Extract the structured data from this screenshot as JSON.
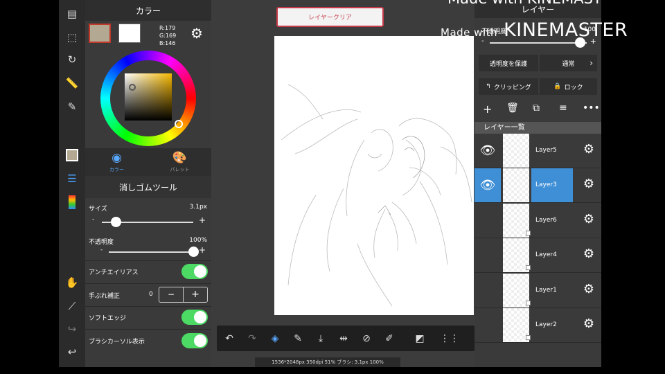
{
  "color_panel": {
    "title": "カラー",
    "rgb": {
      "r": "R:179",
      "g": "G:169",
      "b": "B:146"
    },
    "primary_color": "#b3a992",
    "tabs": [
      {
        "label": "カラー"
      },
      {
        "label": "パレット"
      }
    ]
  },
  "tool": {
    "name": "消しゴムツール",
    "size_label": "サイズ",
    "size_value": "3.1px",
    "opacity_label": "不透明度",
    "opacity_value": "100%",
    "size_fraction": 0.15,
    "opacity_fraction": 1.0,
    "antialias_label": "アンチエイリアス",
    "stabilizer_label": "手ぶれ補正",
    "stabilizer_value": "0",
    "soft_edge_label": "ソフトエッジ",
    "brush_cursor_label": "ブラシカーソル表示",
    "minus": "-",
    "plus": "+",
    "stepper_minus": "−",
    "stepper_plus": "+"
  },
  "canvas": {
    "clear_button": "レイヤークリア",
    "status": "1536*2048px 350dpi 51% ブラシ: 3.1px 100%"
  },
  "layer_panel": {
    "title": "レイヤー",
    "opacity_label": "不透明度",
    "opacity_value": "100",
    "protect_alpha": "透明度を保護",
    "blend_mode": "通常",
    "clipping": "クリッピング",
    "lock": "ロック",
    "list_header": "レイヤー一覧",
    "layers": [
      {
        "name": "Layer5"
      },
      {
        "name": "Layer3"
      },
      {
        "name": "Layer6"
      },
      {
        "name": "Layer4"
      },
      {
        "name": "Layer1"
      },
      {
        "name": "Layer2"
      }
    ]
  },
  "watermark": {
    "made_with": "Made with",
    "brand": "KINEMASTER",
    "top": "Made with KINEMASTER"
  },
  "colors": {
    "accent": "#3f8fd6",
    "toggle_on": "#4cd964",
    "clear_red": "#c63b4a"
  }
}
